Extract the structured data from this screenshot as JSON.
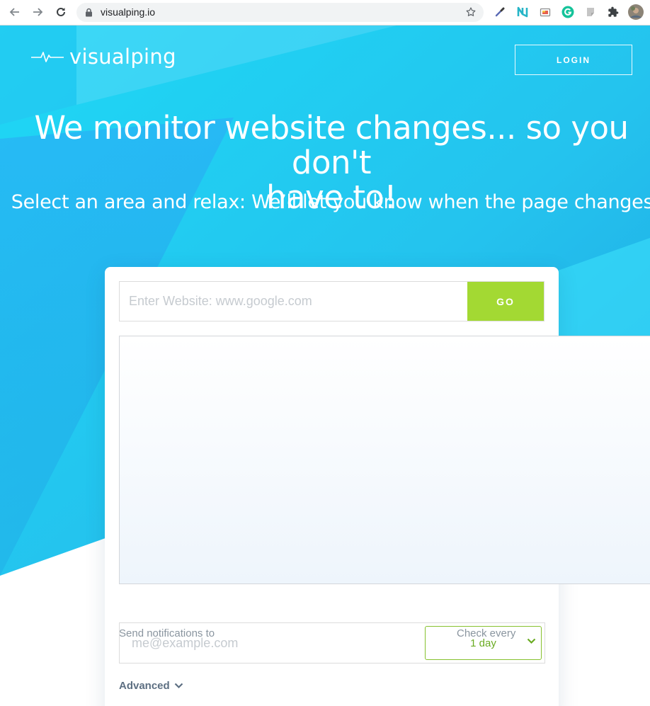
{
  "browser": {
    "url": "visualping.io",
    "extensions": [
      "eyedropper-icon",
      "n-extension-icon",
      "screenshot-extension-icon",
      "grammarly-icon",
      "gray-extension-icon",
      "puzzle-icon",
      "profile-avatar"
    ]
  },
  "header": {
    "logo_text": "visualping",
    "login_label": "LOGIN"
  },
  "hero": {
    "headline_line1": "We monitor website changes... so you don't",
    "headline_line2": "have to!",
    "subheadline": "Select an area and relax: We’ll let you know when the page changes"
  },
  "form": {
    "url_placeholder": "Enter Website: www.google.com",
    "go_label": "GO",
    "notifications_label": "Send notifications to",
    "email_placeholder": "me@example.com",
    "check_every_label": "Check every",
    "frequency_value": "1 day",
    "advanced_label": "Advanced"
  },
  "colors": {
    "hero_primary": "#27c8ef",
    "hero_dark": "#1f9fe3",
    "go_button": "#a3d933",
    "frequency_accent": "#6aab22"
  }
}
